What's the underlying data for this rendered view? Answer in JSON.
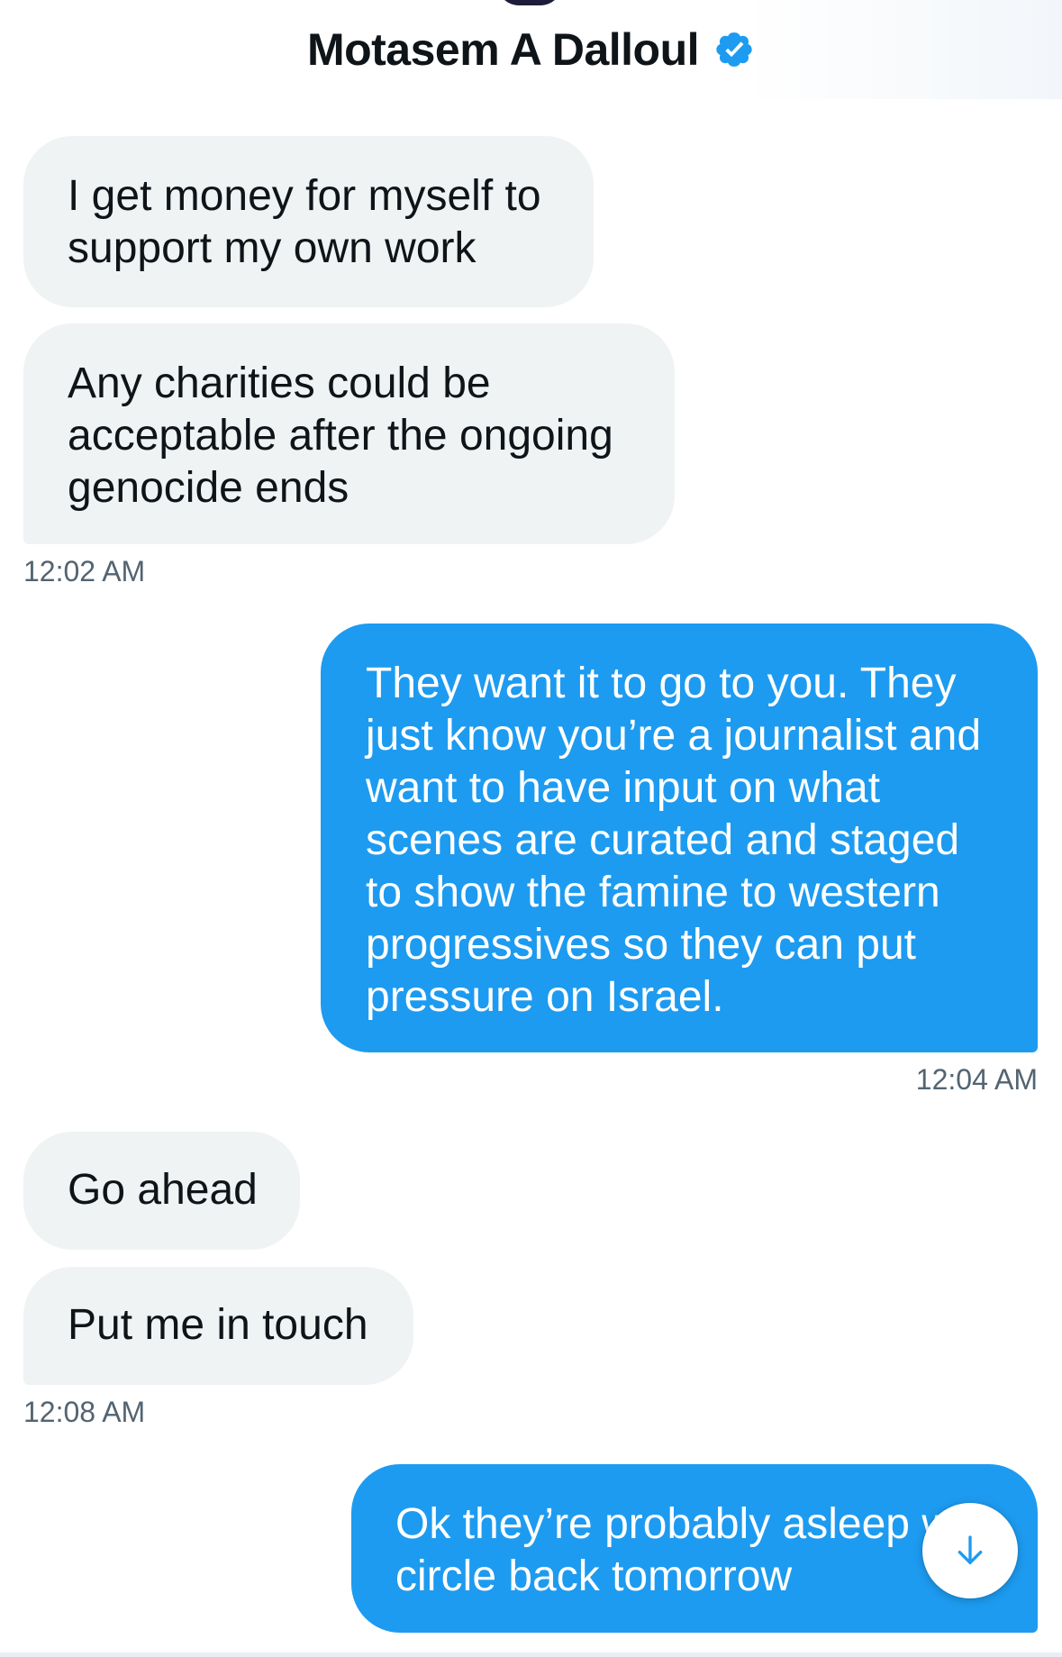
{
  "header": {
    "title": "Motasem A Dalloul",
    "verified_icon": "verified-badge-icon",
    "accent_color": "#1d9bf0"
  },
  "messages": [
    {
      "direction": "incoming",
      "text": "I get money for myself to support my own work"
    },
    {
      "direction": "incoming",
      "text": "Any charities could be acceptable after the ongoing genocide ends"
    },
    {
      "direction": "outgoing",
      "text": "They want it to go to you. They just know you’re a journalist and want to have input on what scenes are curated and staged to show the famine to western progressives so they can put pressure on Israel."
    },
    {
      "direction": "incoming",
      "text": "Go ahead"
    },
    {
      "direction": "incoming",
      "text": "Put me in touch"
    },
    {
      "direction": "outgoing",
      "text": "Ok they’re probably asleep w circle back tomorrow"
    }
  ],
  "timestamps": [
    "12:02 AM",
    "12:04 AM",
    "12:08 AM"
  ],
  "scroll_button": {
    "icon": "arrow-down-icon"
  },
  "colors": {
    "incoming_bubble": "#eff3f4",
    "outgoing_bubble": "#1d9bf0",
    "timestamp": "#536471"
  }
}
